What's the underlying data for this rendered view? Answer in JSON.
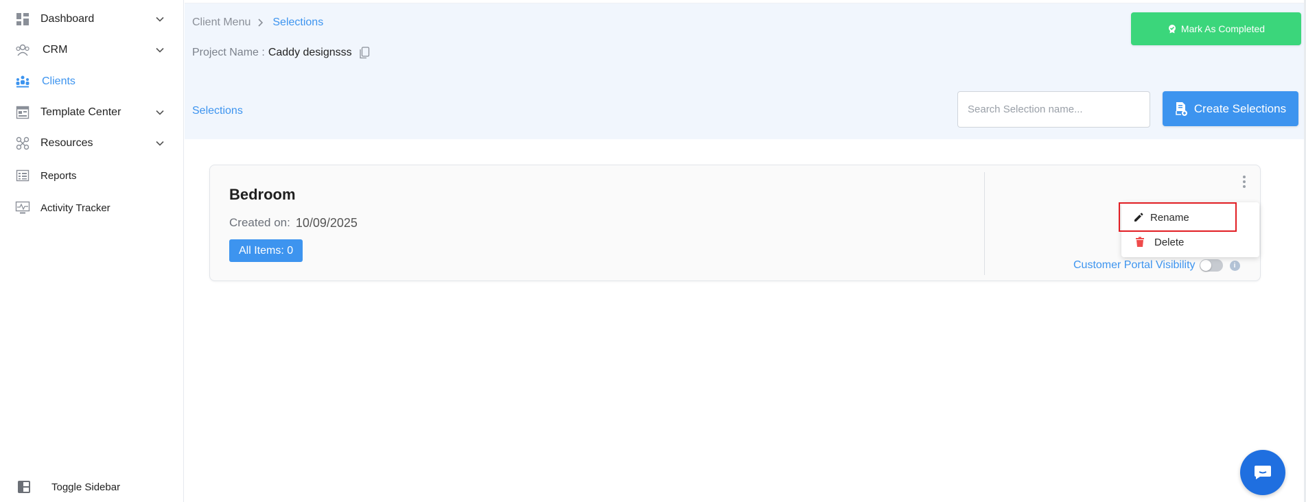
{
  "sidebar": {
    "items": [
      {
        "label": "Dashboard",
        "icon": "dashboard-icon",
        "has_chevron": true
      },
      {
        "label": "CRM",
        "icon": "crm-icon",
        "has_chevron": true
      },
      {
        "label": "Clients",
        "icon": "clients-icon",
        "active": true
      },
      {
        "label": "Template Center",
        "icon": "template-icon",
        "has_chevron": true
      },
      {
        "label": "Resources",
        "icon": "resources-icon",
        "has_chevron": true
      },
      {
        "label": "Reports",
        "icon": "reports-icon"
      },
      {
        "label": "Activity Tracker",
        "icon": "activity-icon"
      }
    ],
    "toggle_label": "Toggle Sidebar"
  },
  "breadcrumb": {
    "parent": "Client Menu",
    "current": "Selections"
  },
  "project": {
    "label": "Project Name :",
    "value": "Caddy designsss"
  },
  "header": {
    "mark_completed_label": "Mark As Completed",
    "section_label": "Selections",
    "search_placeholder": "Search Selection name...",
    "create_label": "Create Selections"
  },
  "card": {
    "title": "Bedroom",
    "created_label": "Created on:",
    "created_value": "10/09/2025",
    "all_items_label": "All Items: 0",
    "portal_visibility_label": "Customer Portal Visibility",
    "portal_visibility_on": false
  },
  "menu": {
    "rename_label": "Rename",
    "delete_label": "Delete"
  },
  "colors": {
    "accent": "#3d94ef",
    "success": "#3bd67b",
    "danger": "#ef4b4b",
    "highlight": "#e11d23",
    "chat": "#1f6fe0"
  }
}
